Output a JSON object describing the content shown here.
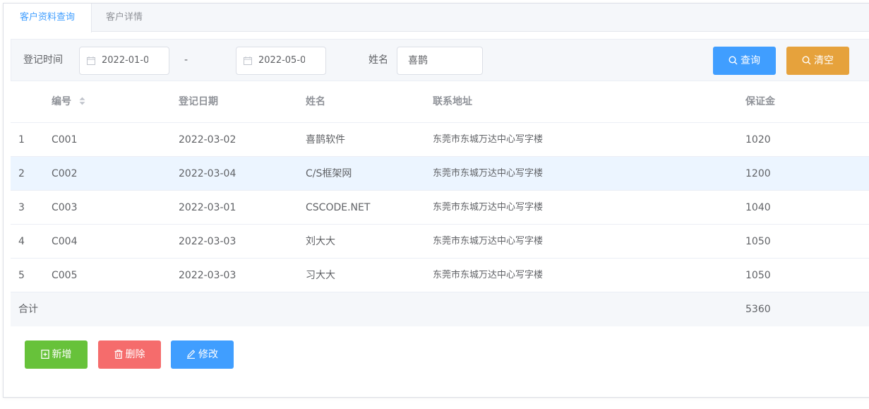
{
  "tabs": [
    {
      "label": "客户资料查询",
      "active": true
    },
    {
      "label": "客户详情",
      "active": false
    }
  ],
  "filter": {
    "date_label": "登记时间",
    "date_from": "2022-01-0",
    "separator": "-",
    "date_to": "2022-05-0",
    "name_label": "姓名",
    "name_value": "喜鹊",
    "query_label": "查询",
    "clear_label": "清空"
  },
  "table": {
    "columns": {
      "code": "编号",
      "date": "登记日期",
      "name": "姓名",
      "address": "联系地址",
      "deposit": "保证金"
    },
    "rows": [
      {
        "idx": "1",
        "code": "C001",
        "date": "2022-03-02",
        "name": "喜鹊软件",
        "address": "东莞市东城万达中心写字楼",
        "deposit": "1020"
      },
      {
        "idx": "2",
        "code": "C002",
        "date": "2022-03-04",
        "name": "C/S框架网",
        "address": "东莞市东城万达中心写字楼",
        "deposit": "1200"
      },
      {
        "idx": "3",
        "code": "C003",
        "date": "2022-03-01",
        "name": "CSCODE.NET",
        "address": "东莞市东城万达中心写字楼",
        "deposit": "1040"
      },
      {
        "idx": "4",
        "code": "C004",
        "date": "2022-03-03",
        "name": "刘大大",
        "address": "东莞市东城万达中心写字楼",
        "deposit": "1050"
      },
      {
        "idx": "5",
        "code": "C005",
        "date": "2022-03-03",
        "name": "习大大",
        "address": "东莞市东城万达中心写字楼",
        "deposit": "1050"
      }
    ],
    "summary": {
      "label": "合计",
      "deposit": "5360"
    }
  },
  "actions": {
    "add_label": "新增",
    "delete_label": "删除",
    "edit_label": "修改"
  },
  "colors": {
    "primary": "#409eff",
    "warning": "#e6a23c",
    "success": "#67c23a",
    "danger": "#f56c6c",
    "row_highlight": "#ecf5ff"
  },
  "icons": {
    "date": "calendar-icon",
    "query": "search-icon",
    "clear": "search-icon",
    "sort": "sort-icon",
    "add": "add-file-icon",
    "delete": "trash-icon",
    "edit": "pencil-icon"
  }
}
